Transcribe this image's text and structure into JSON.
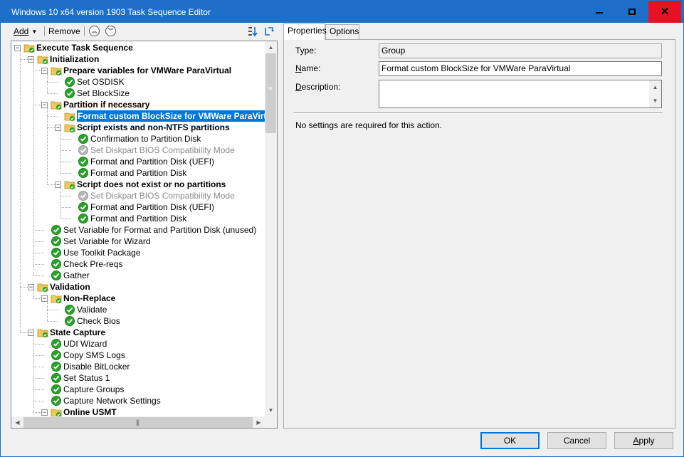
{
  "window": {
    "title": "Windows 10 x64 version 1903 Task Sequence Editor",
    "controls": {
      "minimize": "–",
      "maximize": "□",
      "close": "✕"
    }
  },
  "toolbar": {
    "add_label": "Add",
    "remove_label": "Remove",
    "move_up_icon": "double-chevron-up-icon",
    "move_down_icon": "double-chevron-down-icon"
  },
  "tree": {
    "items": [
      {
        "label": "Execute Task Sequence",
        "type": "group",
        "level": 0,
        "expander": "−"
      },
      {
        "label": "Initialization",
        "type": "group",
        "level": 1,
        "expander": "−"
      },
      {
        "label": "Prepare variables for VMWare ParaVirtual",
        "type": "group",
        "level": 2,
        "expander": "−"
      },
      {
        "label": "Set OSDISK",
        "type": "step",
        "level": 3,
        "status": "ok"
      },
      {
        "label": "Set BlockSize",
        "type": "step",
        "level": 3,
        "status": "ok"
      },
      {
        "label": "Partition if necessary",
        "type": "group",
        "level": 2,
        "expander": "−"
      },
      {
        "label": "Format custom BlockSize for VMWare ParaVirtual",
        "type": "group",
        "level": 3,
        "selected": true
      },
      {
        "label": "Script exists and non-NTFS partitions",
        "type": "group",
        "level": 3,
        "expander": "−"
      },
      {
        "label": "Confirmation to Partition Disk",
        "type": "step",
        "level": 4,
        "status": "ok"
      },
      {
        "label": "Set Diskpart BIOS Compatibility Mode",
        "type": "step",
        "level": 4,
        "status": "disabled"
      },
      {
        "label": "Format and Partition Disk (UEFI)",
        "type": "step",
        "level": 4,
        "status": "ok"
      },
      {
        "label": "Format and Partition Disk",
        "type": "step",
        "level": 4,
        "status": "ok"
      },
      {
        "label": "Script does not exist or no partitions",
        "type": "group",
        "level": 3,
        "expander": "−"
      },
      {
        "label": "Set Diskpart BIOS Compatibility Mode",
        "type": "step",
        "level": 4,
        "status": "disabled"
      },
      {
        "label": "Format and Partition Disk (UEFI)",
        "type": "step",
        "level": 4,
        "status": "ok"
      },
      {
        "label": "Format and Partition Disk",
        "type": "step",
        "level": 4,
        "status": "ok"
      },
      {
        "label": "Set Variable for Format and Partition Disk (unused)",
        "type": "step",
        "level": 2,
        "status": "ok"
      },
      {
        "label": "Set Variable for Wizard",
        "type": "step",
        "level": 2,
        "status": "ok"
      },
      {
        "label": "Use Toolkit Package",
        "type": "step",
        "level": 2,
        "status": "ok"
      },
      {
        "label": "Check Pre-reqs",
        "type": "step",
        "level": 2,
        "status": "ok"
      },
      {
        "label": "Gather",
        "type": "step",
        "level": 2,
        "status": "ok"
      },
      {
        "label": "Validation",
        "type": "group",
        "level": 1,
        "expander": "−"
      },
      {
        "label": "Non-Replace",
        "type": "group",
        "level": 2,
        "expander": "−"
      },
      {
        "label": "Validate",
        "type": "step",
        "level": 3,
        "status": "ok"
      },
      {
        "label": "Check Bios",
        "type": "step",
        "level": 3,
        "status": "ok"
      },
      {
        "label": "State Capture",
        "type": "group",
        "level": 1,
        "expander": "−"
      },
      {
        "label": "UDI Wizard",
        "type": "step",
        "level": 2,
        "status": "ok"
      },
      {
        "label": "Copy SMS Logs",
        "type": "step",
        "level": 2,
        "status": "ok"
      },
      {
        "label": "Disable BitLocker",
        "type": "step",
        "level": 2,
        "status": "ok"
      },
      {
        "label": "Set Status 1",
        "type": "step",
        "level": 2,
        "status": "ok"
      },
      {
        "label": "Capture Groups",
        "type": "step",
        "level": 2,
        "status": "ok"
      },
      {
        "label": "Capture Network Settings",
        "type": "step",
        "level": 2,
        "status": "ok"
      },
      {
        "label": "Online USMT",
        "type": "group",
        "level": 2,
        "expander": "−"
      }
    ]
  },
  "tabs": [
    {
      "label": "Properties",
      "active": true
    },
    {
      "label": "Options",
      "active": false
    }
  ],
  "properties": {
    "type_label": "Type:",
    "type_value": "Group",
    "name_label": "Name:",
    "name_value": "Format custom BlockSize for VMWare ParaVirtual",
    "description_label": "Description:",
    "description_value": "",
    "note": "No settings are required  for this action."
  },
  "buttons": {
    "ok": "OK",
    "cancel": "Cancel",
    "apply": "Apply"
  },
  "colors": {
    "titlebar": "#1e6fc8",
    "selection": "#0078d7",
    "close_hover": "#e81123",
    "check_green": "#2aa12a",
    "folder_yellow": "#f0cc5c"
  }
}
